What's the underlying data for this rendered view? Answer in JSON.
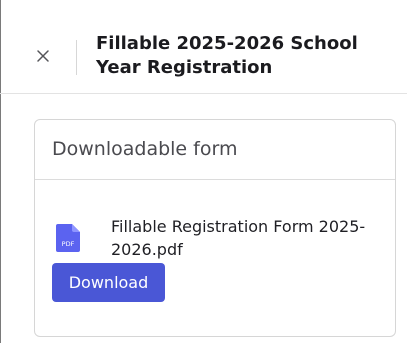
{
  "header": {
    "title": "Fillable 2025-2026 School Year Registration"
  },
  "card": {
    "title": "Downloadable form",
    "file": {
      "icon": "pdf-file-icon",
      "icon_label": "PDF",
      "name": "Fillable Registration Form 2025-2026.pdf"
    },
    "download_label": "Download"
  },
  "colors": {
    "accent": "#4a57d6",
    "file_icon": "#5b63f0"
  }
}
